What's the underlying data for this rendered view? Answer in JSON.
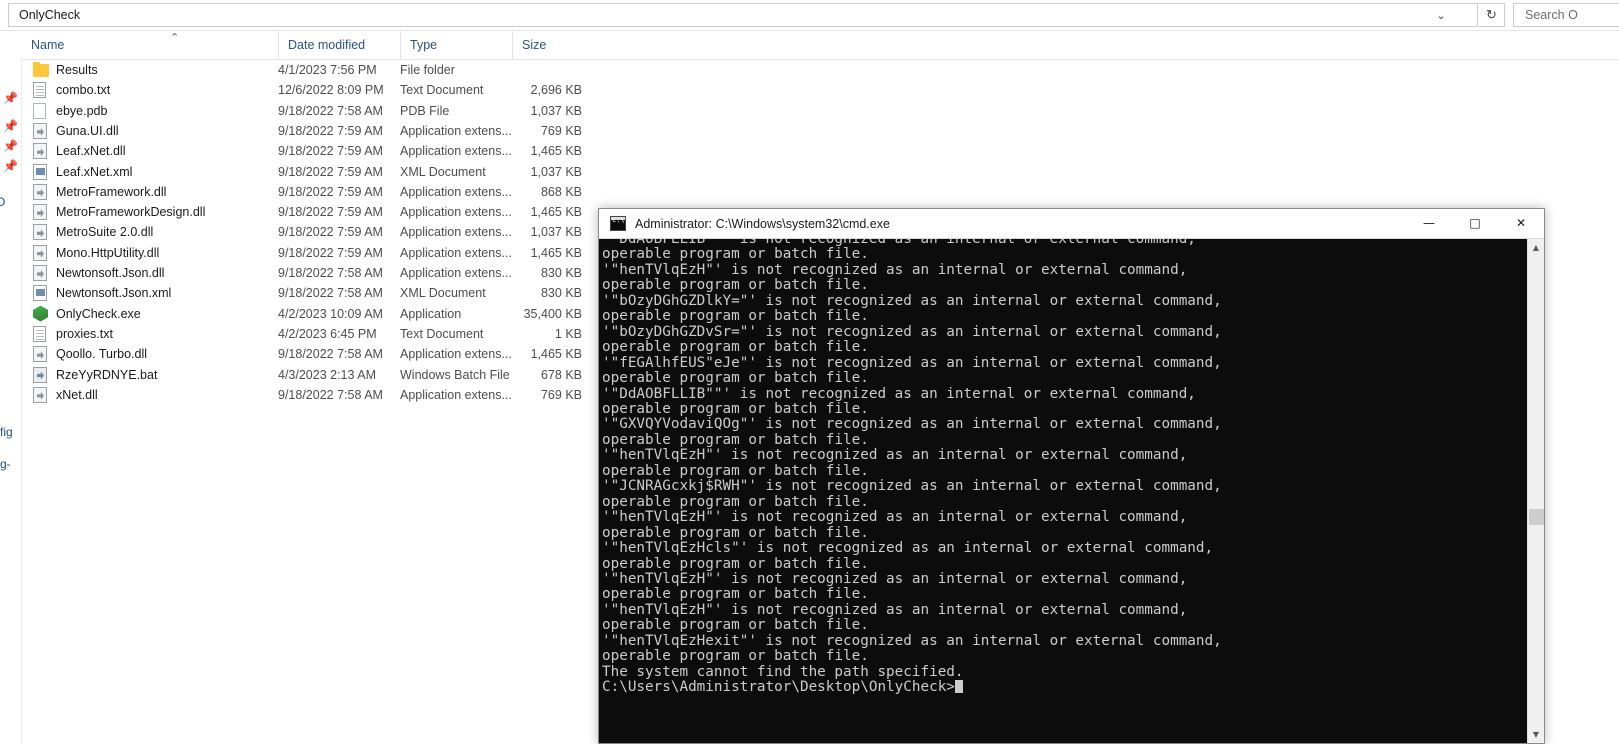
{
  "explorer": {
    "address": {
      "path": "OnlyCheck",
      "chevron_icon": "chevron-down-icon",
      "refresh_icon": "refresh-icon"
    },
    "search": {
      "placeholder": "Search O"
    },
    "columns": [
      {
        "label": "Name",
        "sort": "ascending"
      },
      {
        "label": "Date modified",
        "sort": ""
      },
      {
        "label": "Type",
        "sort": ""
      },
      {
        "label": "Size",
        "sort": ""
      }
    ],
    "sort_caret": "⌃",
    "nav_clipped_labels": [
      "fig",
      "g-"
    ],
    "nav_pin_icon": "pin-icon",
    "files": [
      {
        "name": "Results",
        "date": "4/1/2023 7:56 PM",
        "type": "File folder",
        "size": "",
        "icon": "folder-icon"
      },
      {
        "name": "combo.txt",
        "date": "12/6/2022 8:09 PM",
        "type": "Text Document",
        "size": "2,696 KB",
        "icon": "text-document-icon"
      },
      {
        "name": "ebye.pdb",
        "date": "9/18/2022 7:58 AM",
        "type": "PDB File",
        "size": "1,037 KB",
        "icon": "blank-file-icon"
      },
      {
        "name": "Guna.UI.dll",
        "date": "9/18/2022 7:59 AM",
        "type": "Application extens...",
        "size": "769 KB",
        "icon": "dll-icon"
      },
      {
        "name": "Leaf.xNet.dll",
        "date": "9/18/2022 7:59 AM",
        "type": "Application extens...",
        "size": "1,465 KB",
        "icon": "dll-icon"
      },
      {
        "name": "Leaf.xNet.xml",
        "date": "9/18/2022 7:59 AM",
        "type": "XML Document",
        "size": "1,037 KB",
        "icon": "xml-icon"
      },
      {
        "name": "MetroFramework.dll",
        "date": "9/18/2022 7:59 AM",
        "type": "Application extens...",
        "size": "868 KB",
        "icon": "dll-icon"
      },
      {
        "name": "MetroFrameworkDesign.dll",
        "date": "9/18/2022 7:59 AM",
        "type": "Application extens...",
        "size": "1,465 KB",
        "icon": "dll-icon"
      },
      {
        "name": "MetroSuite 2.0.dll",
        "date": "9/18/2022 7:59 AM",
        "type": "Application extens...",
        "size": "1,037 KB",
        "icon": "dll-icon"
      },
      {
        "name": "Mono.HttpUtility.dll",
        "date": "9/18/2022 7:59 AM",
        "type": "Application extens...",
        "size": "1,465 KB",
        "icon": "dll-icon"
      },
      {
        "name": "Newtonsoft.Json.dll",
        "date": "9/18/2022 7:58 AM",
        "type": "Application extens...",
        "size": "830 KB",
        "icon": "dll-icon"
      },
      {
        "name": "Newtonsoft.Json.xml",
        "date": "9/18/2022 7:58 AM",
        "type": "XML Document",
        "size": "830 KB",
        "icon": "xml-icon"
      },
      {
        "name": "OnlyCheck.exe",
        "date": "4/2/2023 10:09 AM",
        "type": "Application",
        "size": "35,400 KB",
        "icon": "application-icon"
      },
      {
        "name": "proxies.txt",
        "date": "4/2/2023 6:45 PM",
        "type": "Text Document",
        "size": "1 KB",
        "icon": "text-document-icon"
      },
      {
        "name": "Qoollo. Turbo.dll",
        "date": "9/18/2022 7:58 AM",
        "type": "Application extens...",
        "size": "1,465 KB",
        "icon": "dll-icon"
      },
      {
        "name": "RzeYyRDNYE.bat",
        "date": "4/3/2023 2:13 AM",
        "type": "Windows Batch File",
        "size": "678 KB",
        "icon": "batch-file-icon"
      },
      {
        "name": "xNet.dll",
        "date": "9/18/2022 7:58 AM",
        "type": "Application extens...",
        "size": "769 KB",
        "icon": "dll-icon"
      }
    ]
  },
  "console": {
    "title": "Administrator: C:\\Windows\\system32\\cmd.exe",
    "title_icon": "cmd-icon",
    "window_buttons": {
      "minimize": "—",
      "maximize": "□",
      "close": "✕"
    },
    "scrollbar": {
      "up_arrow": "▲",
      "down_arrow": "▼"
    },
    "output": "'\"DdAOBFLLIB\"\"' is not recognized as an internal or external command,\noperable program or batch file.\n'\"henTVlqEzH\"' is not recognized as an internal or external command,\noperable program or batch file.\n'\"bOzyDGhGZDlkY=\"' is not recognized as an internal or external command,\noperable program or batch file.\n'\"bOzyDGhGZDvSr=\"' is not recognized as an internal or external command,\noperable program or batch file.\n'\"fEGAlhfEUS\"eJe\"' is not recognized as an internal or external command,\noperable program or batch file.\n'\"DdAOBFLLIB\"\"' is not recognized as an internal or external command,\noperable program or batch file.\n'\"GXVQYVodaviQOg\"' is not recognized as an internal or external command,\noperable program or batch file.\n'\"henTVlqEzH\"' is not recognized as an internal or external command,\noperable program or batch file.\n'\"JCNRAGcxkj$RWH\"' is not recognized as an internal or external command,\noperable program or batch file.\n'\"henTVlqEzH\"' is not recognized as an internal or external command,\noperable program or batch file.\n'\"henTVlqEzHcls\"' is not recognized as an internal or external command,\noperable program or batch file.\n'\"henTVlqEzH\"' is not recognized as an internal or external command,\noperable program or batch file.\n'\"henTVlqEzH\"' is not recognized as an internal or external command,\noperable program or batch file.\n'\"henTVlqEzHexit\"' is not recognized as an internal or external command,\noperable program or batch file.\nThe system cannot find the path specified.",
    "prompt": "C:\\Users\\Administrator\\Desktop\\OnlyCheck>"
  }
}
